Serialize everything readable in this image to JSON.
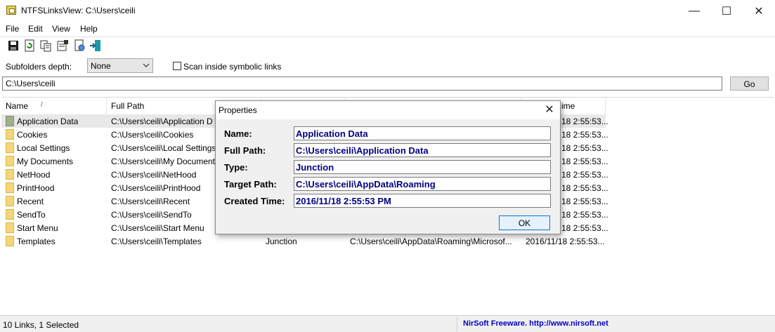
{
  "window": {
    "title": "NTFSLinksView:  C:\\Users\\ceili",
    "minimize_glyph": "—",
    "maximize_glyph": "☐",
    "close_glyph": "✕"
  },
  "menu": [
    "File",
    "Edit",
    "View",
    "Help"
  ],
  "toolbar": {
    "icons": [
      "save-icon",
      "refresh-icon",
      "copy-icon",
      "properties-icon",
      "html-report-icon",
      "exit-icon"
    ]
  },
  "options": {
    "depth_label": "Subfolders depth:",
    "depth_value": "None",
    "scan_label": "Scan inside symbolic links",
    "scan_checked": false
  },
  "path_bar": {
    "value": "C:\\Users\\ceili",
    "go_label": "Go"
  },
  "list": {
    "columns": [
      "Name",
      "Full Path",
      "",
      "",
      "ime"
    ],
    "sort_glyph": "/",
    "rows": [
      {
        "name": "Application Data",
        "path": "C:\\Users\\ceili\\Application D",
        "type": "",
        "target": "",
        "time": "18 2:55:53...",
        "selected": true
      },
      {
        "name": "Cookies",
        "path": "C:\\Users\\ceili\\Cookies",
        "type": "",
        "target": "",
        "time": "18 2:55:53..."
      },
      {
        "name": "Local Settings",
        "path": "C:\\Users\\ceili\\Local Settings",
        "type": "",
        "target": "",
        "time": "18 2:55:53..."
      },
      {
        "name": "My Documents",
        "path": "C:\\Users\\ceili\\My Document",
        "type": "",
        "target": "",
        "time": "18 2:55:53..."
      },
      {
        "name": "NetHood",
        "path": "C:\\Users\\ceili\\NetHood",
        "type": "",
        "target": "",
        "time": "18 2:55:53..."
      },
      {
        "name": "PrintHood",
        "path": "C:\\Users\\ceili\\PrintHood",
        "type": "",
        "target": "",
        "time": "18 2:55:53..."
      },
      {
        "name": "Recent",
        "path": "C:\\Users\\ceili\\Recent",
        "type": "",
        "target": "",
        "time": "18 2:55:53..."
      },
      {
        "name": "SendTo",
        "path": "C:\\Users\\ceili\\SendTo",
        "type": "",
        "target": "",
        "time": "18 2:55:53..."
      },
      {
        "name": "Start Menu",
        "path": "C:\\Users\\ceili\\Start Menu",
        "type": "",
        "target": "",
        "time": "18 2:55:53..."
      },
      {
        "name": "Templates",
        "path": "C:\\Users\\ceili\\Templates",
        "type": "Junction",
        "target": "C:\\Users\\ceili\\AppData\\Roaming\\Microsof...",
        "time": "2016/11/18 2:55:53..."
      }
    ]
  },
  "status": {
    "text": "10 Links, 1 Selected",
    "link": "NirSoft Freeware.  http://www.nirsoft.net"
  },
  "dialog": {
    "title": "Properties",
    "close_glyph": "✕",
    "fields": [
      {
        "label": "Name:",
        "value": "Application Data"
      },
      {
        "label": "Full Path:",
        "value": "C:\\Users\\ceili\\Application Data"
      },
      {
        "label": "Type:",
        "value": "Junction"
      },
      {
        "label": "Target Path:",
        "value": "C:\\Users\\ceili\\AppData\\Roaming"
      },
      {
        "label": "Created Time:",
        "value": "2016/11/18 2:55:53 PM"
      }
    ],
    "ok_label": "OK"
  },
  "colors": {
    "field_text": "#000080",
    "link": "#0000cc",
    "selection": "#e8e8e8"
  }
}
